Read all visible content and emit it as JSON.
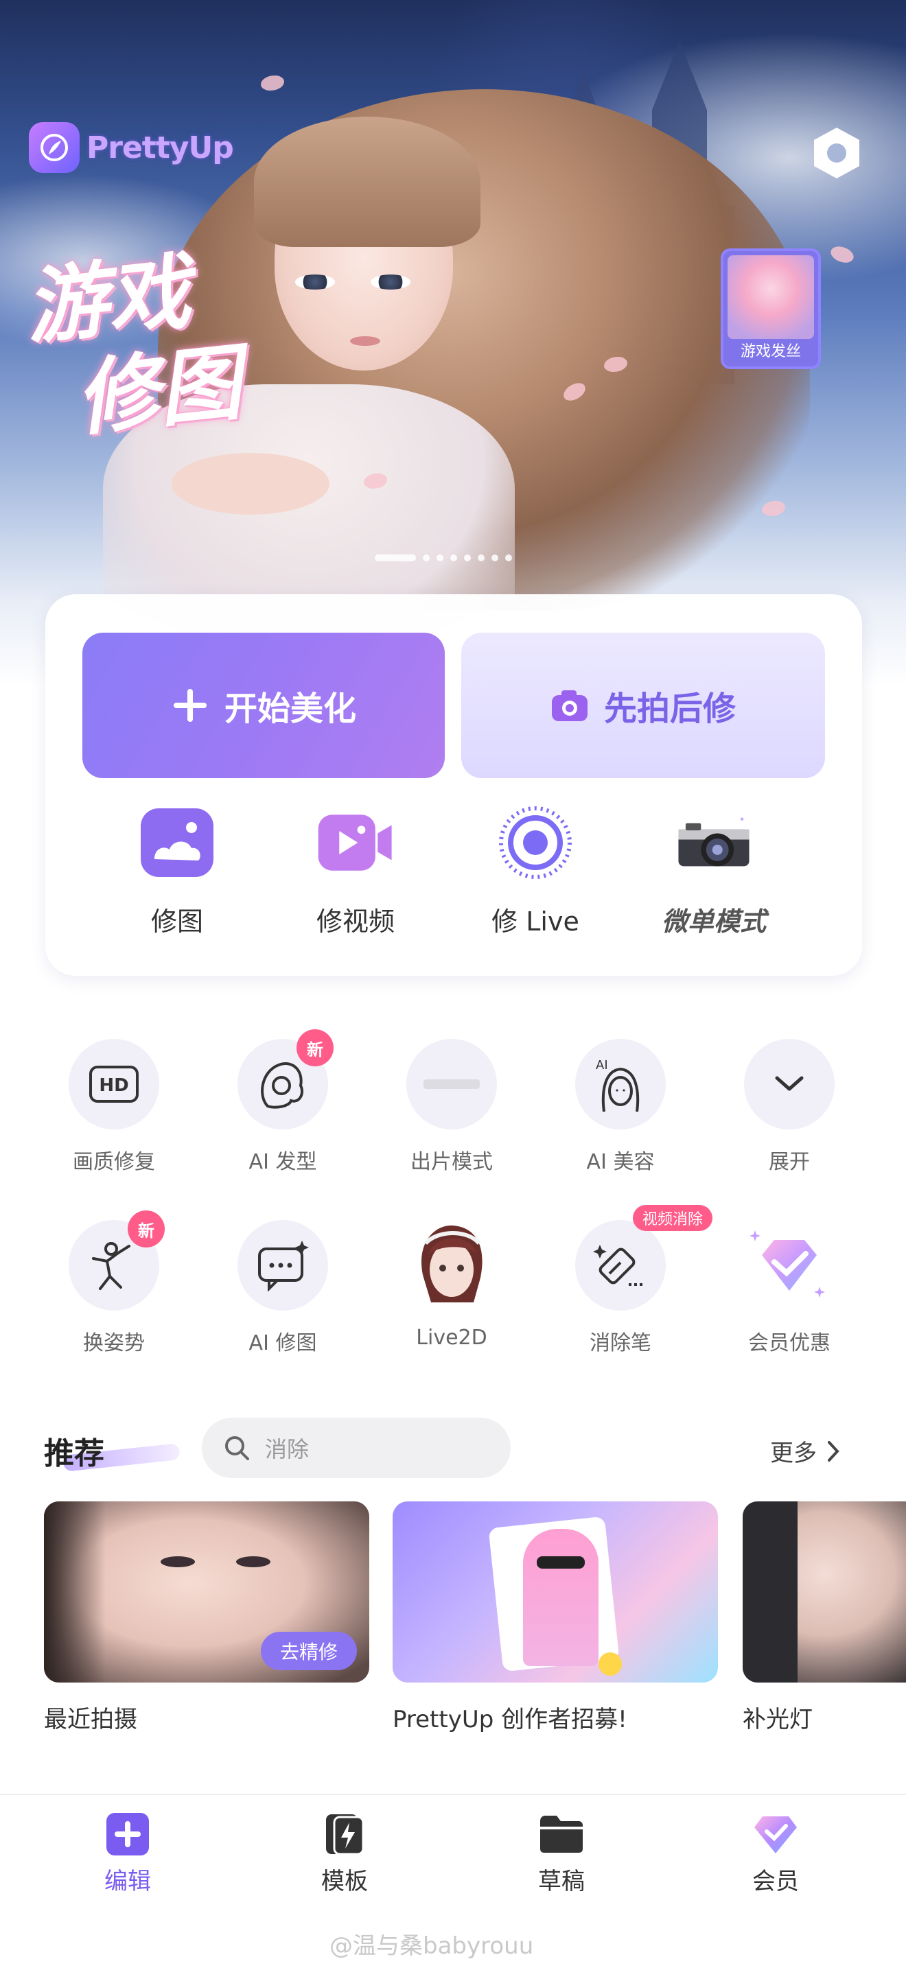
{
  "banner": {
    "logo_text": "PrettyUp",
    "title_line1": "游戏",
    "title_line2": "修图",
    "thumb_label": "游戏发丝",
    "page_count": 9,
    "active_page": 1
  },
  "actions": {
    "primary_label": "开始美化",
    "secondary_label": "先拍后修"
  },
  "quick_tools": [
    {
      "label": "修图"
    },
    {
      "label": "修视频"
    },
    {
      "label": "修 Live"
    },
    {
      "label": "微单模式"
    }
  ],
  "features": [
    {
      "label": "画质修复",
      "icon": "hd-icon"
    },
    {
      "label": "AI 发型",
      "icon": "hairstyle-icon",
      "badge": "新"
    },
    {
      "label": "出片模式",
      "icon": "photo-mode-icon"
    },
    {
      "label": "AI 美容",
      "icon": "ai-beauty-icon"
    },
    {
      "label": "展开",
      "icon": "chevron-down-icon"
    },
    {
      "label": "换姿势",
      "icon": "pose-icon",
      "badge": "新"
    },
    {
      "label": "AI 修图",
      "icon": "ai-edit-icon"
    },
    {
      "label": "Live2D",
      "icon": "live2d-avatar"
    },
    {
      "label": "消除笔",
      "icon": "eraser-icon",
      "tag": "视频消除"
    },
    {
      "label": "会员优惠",
      "icon": "diamond-icon"
    }
  ],
  "recommend": {
    "title": "推荐",
    "search_placeholder": "消除",
    "more_label": "更多",
    "cards": [
      {
        "label": "最近拍摄",
        "chip": "去精修"
      },
      {
        "label": "PrettyUp 创作者招募!"
      },
      {
        "label": "补光灯"
      }
    ]
  },
  "tabbar": {
    "tabs": [
      {
        "label": "编辑",
        "active": true
      },
      {
        "label": "模板"
      },
      {
        "label": "草稿"
      },
      {
        "label": "会员"
      }
    ]
  },
  "watermark": "@温与桑babyrouu",
  "colors": {
    "accent": "#7a5cf0",
    "badge": "#ff5c8a"
  }
}
